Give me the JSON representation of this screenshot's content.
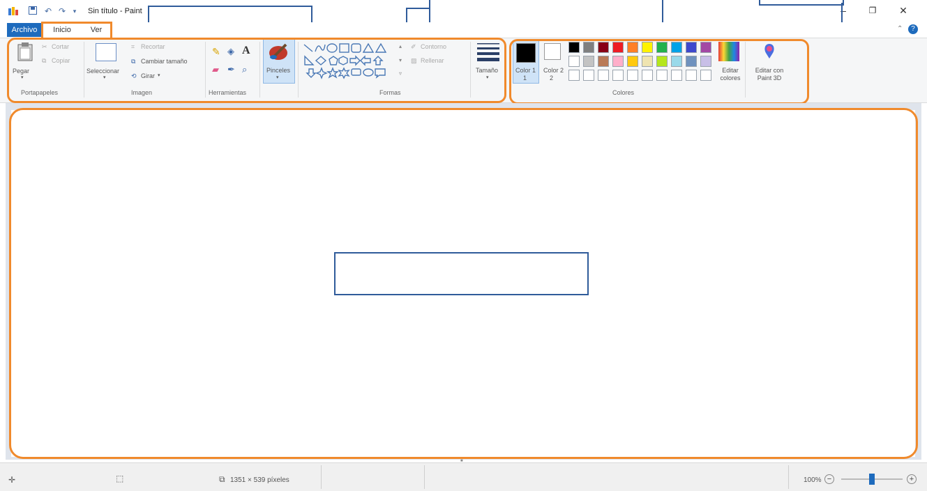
{
  "title_bar": {
    "title": "Sin título - Paint",
    "minimize": "–",
    "restore": "❐",
    "close": "✕"
  },
  "menu": {
    "archivo": "Archivo",
    "tabs": [
      "Inicio",
      "Ver"
    ]
  },
  "ribbon": {
    "clipboard": {
      "label": "Portapapeles",
      "paste": "Pegar",
      "cut": "Cortar",
      "copy": "Copiar"
    },
    "image": {
      "label": "Imagen",
      "select": "Seleccionar",
      "crop": "Recortar",
      "resize": "Cambiar tamaño",
      "rotate": "Girar"
    },
    "tools": {
      "label": "Herramientas",
      "text_tool": "A"
    },
    "brushes": {
      "label": "Pinceles"
    },
    "shapes": {
      "label": "Formas",
      "outline": "Contorno",
      "fill": "Rellenar"
    },
    "size": {
      "label": "Tamaño"
    },
    "colors": {
      "label": "Colores",
      "color1": "Color 1",
      "color1_num": "1",
      "color2": "Color 2",
      "color2_num": "2",
      "edit": "Editar colores",
      "paint3d": "Editar con Paint 3D",
      "row1": [
        "#000000",
        "#7f7f7f",
        "#880015",
        "#ed1c24",
        "#ff7f27",
        "#fff200",
        "#22b14c",
        "#00a2e8",
        "#3f48cc",
        "#a349a4"
      ],
      "row2": [
        "#ffffff",
        "#c3c3c3",
        "#b97a57",
        "#ffaec9",
        "#ffc90e",
        "#efe4b0",
        "#b5e61d",
        "#99d9ea",
        "#7092be",
        "#c8bfe7"
      ]
    }
  },
  "status": {
    "dimensions": "1351 × 539 píxeles",
    "zoom": "100%",
    "zoom_level": 0.5
  },
  "colors": {
    "accent": "#f08a2c",
    "archivo_bg": "#1e6bbd",
    "callout_border": "#2f5b9a"
  }
}
